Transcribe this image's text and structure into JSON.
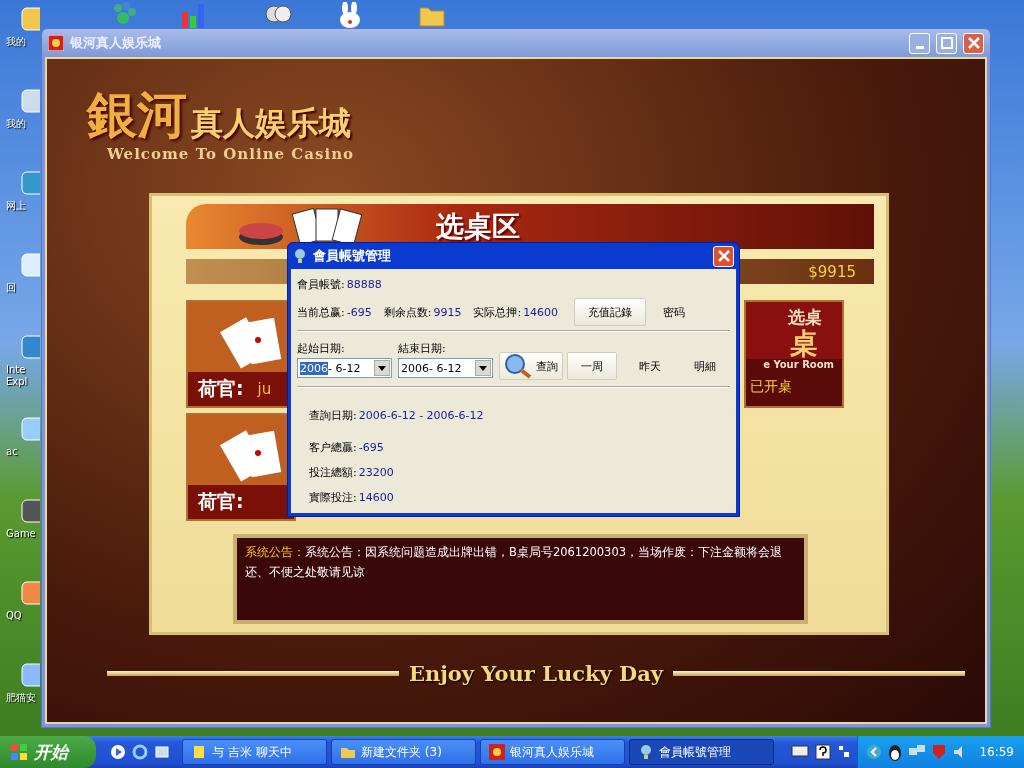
{
  "desktop_icons": [
    {
      "label": "我的"
    },
    {
      "label": "我的"
    },
    {
      "label": "网上"
    },
    {
      "label": "回"
    },
    {
      "label": "Inte Expl"
    },
    {
      "label": "ac"
    },
    {
      "label": "Game"
    },
    {
      "label": "QQ"
    },
    {
      "label": "肥猫安"
    }
  ],
  "window": {
    "title": "银河真人娱乐城"
  },
  "casino": {
    "logo_main": "銀河",
    "logo_rest": "真人娱乐城",
    "logo_subtitle": "Welcome To Online Casino",
    "section_title": "选桌区",
    "balance": "$9915",
    "tables": [
      {
        "label": "荷官:",
        "dealer": "ju"
      },
      {
        "label": "荷官:"
      }
    ],
    "room_card": {
      "title": "选桌",
      "big": "桌",
      "caption": "e Your Room",
      "status": "已开桌"
    },
    "notice": {
      "label": "系统公告：",
      "text": "系统公告：因系统问题造成出牌出错，B桌局号2061200303，当场作废：下注金额将会退还、不便之处敬请见谅"
    },
    "footer": "Enjoy Your Lucky Day"
  },
  "dialog": {
    "title": "會員帳號管理",
    "account": {
      "label": "會員帳號:",
      "value": "88888"
    },
    "stats": [
      {
        "label": "当前总赢:",
        "value": "-695"
      },
      {
        "label": "剩余点数:",
        "value": "9915"
      },
      {
        "label": "实际总押:",
        "value": "14600"
      }
    ],
    "top_buttons": [
      {
        "label": "充值記錄",
        "kind": "raised"
      },
      {
        "label": "密码",
        "kind": "flat"
      }
    ],
    "dates": [
      {
        "label": "起始日期:",
        "value": "2006- 6-12",
        "focused": true
      },
      {
        "label": "結束日期:",
        "value": "2006- 6-12",
        "focused": false
      }
    ],
    "buttons": [
      {
        "label": "查詢",
        "kind": "search"
      },
      {
        "label": "一周",
        "kind": "raised"
      },
      {
        "label": "昨天",
        "kind": "flat"
      },
      {
        "label": "明細",
        "kind": "flat"
      }
    ],
    "results": [
      {
        "label": "查詢日期:",
        "value": "2006-6-12 - 2006-6-12"
      },
      {
        "label": "客户總贏:",
        "value": "-695"
      },
      {
        "label": "投注總額:",
        "value": "23200"
      },
      {
        "label": "實際投注:",
        "value": "14600"
      }
    ]
  },
  "taskbar": {
    "start": "开始",
    "tasks": [
      {
        "label": "与 吉米 聊天中",
        "selected": false
      },
      {
        "label": "新建文件夹 (3)",
        "selected": false
      },
      {
        "label": "银河真人娱乐城",
        "selected": false
      },
      {
        "label": "會員帳號管理",
        "selected": true
      }
    ],
    "clock": "16:59"
  }
}
